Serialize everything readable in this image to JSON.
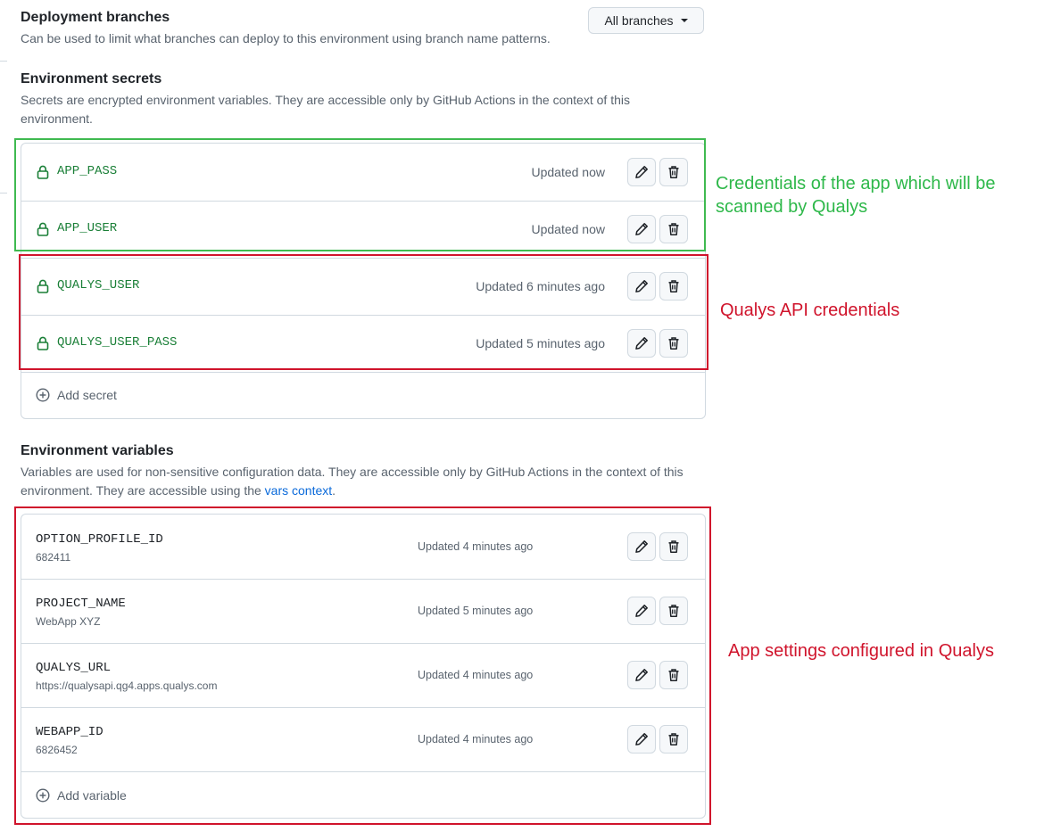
{
  "deployment_branches": {
    "title": "Deployment branches",
    "description": "Can be used to limit what branches can deploy to this environment using branch name patterns.",
    "dropdown_label": "All branches"
  },
  "env_secrets": {
    "title": "Environment secrets",
    "description": "Secrets are encrypted environment variables. They are accessible only by GitHub Actions in the context of this environment.",
    "items": [
      {
        "name": "APP_PASS",
        "updated": "Updated now"
      },
      {
        "name": "APP_USER",
        "updated": "Updated now"
      },
      {
        "name": "QUALYS_USER",
        "updated": "Updated 6 minutes ago"
      },
      {
        "name": "QUALYS_USER_PASS",
        "updated": "Updated 5 minutes ago"
      }
    ],
    "add_label": "Add secret"
  },
  "env_variables": {
    "title": "Environment variables",
    "description_part1": "Variables are used for non-sensitive configuration data. They are accessible only by GitHub Actions in the context of this environment. They are accessible using the ",
    "link_text": "vars context",
    "description_part2": ".",
    "items": [
      {
        "name": "OPTION_PROFILE_ID",
        "value": "682411",
        "updated": "Updated 4 minutes ago"
      },
      {
        "name": "PROJECT_NAME",
        "value": "WebApp XYZ",
        "updated": "Updated 5 minutes ago"
      },
      {
        "name": "QUALYS_URL",
        "value": "https://qualysapi.qg4.apps.qualys.com",
        "updated": "Updated 4 minutes ago"
      },
      {
        "name": "WEBAPP_ID",
        "value": "6826452",
        "updated": "Updated 4 minutes ago"
      }
    ],
    "add_label": "Add variable"
  },
  "annotations": {
    "app_credentials": "Credentials of the app which will be scanned by Qualys",
    "qualys_api": "Qualys API credentials",
    "app_settings": "App settings configured in Qualys"
  },
  "icons": {
    "lock": "lock-icon",
    "edit": "pencil-icon",
    "delete": "trash-icon",
    "add": "plus-circle-icon",
    "dropdown": "triangle-down-icon"
  },
  "colors": {
    "secret_name": "#1a7f37",
    "link": "#0969da",
    "annotation_green": "#2eb84a",
    "annotation_red": "#d0142c"
  }
}
